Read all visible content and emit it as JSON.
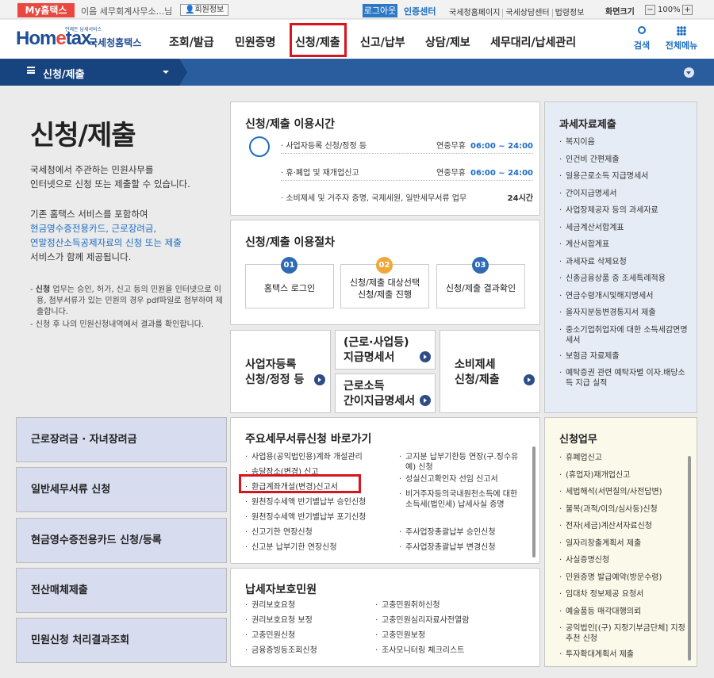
{
  "topbar": {
    "my_home": "My홈택스",
    "user_text": "이음 세무회계사무소...님",
    "member_info": "회원정보",
    "logout": "로그아웃",
    "cert_center": "인증센터",
    "links": [
      "국세청홈페이지",
      "국세상담센터",
      "법령정보"
    ],
    "screen_size_label": "화면크기",
    "zoom_minus": "−",
    "zoom_value": "100%",
    "zoom_plus": "+"
  },
  "header": {
    "logo_small": "언제든 납세서비스",
    "logo_home": "Hom",
    "logo_e": "e",
    "logo_tax": "tax.",
    "logo_kr": "국세청홈택스",
    "menu": [
      "조회/발급",
      "민원증명",
      "신청/제출",
      "신고/납부",
      "상담/제보",
      "세무대리/납세관리"
    ],
    "search": "검색",
    "all_menu": "전체메뉴"
  },
  "subnav": {
    "title": "신청/제출"
  },
  "page": {
    "title": "신청/제출",
    "intro1_line1": "국세청에서 주관하는 민원사무를",
    "intro1_line2": "인터넷으로 신청 또는 제출할 수 있습니다.",
    "intro2_line1": "기존 홈택스 서비스를 포함하여",
    "intro2_blue1": "현금영수증전용카드, 근로장려금,",
    "intro2_blue2": "연말정산소득공제자료의 신청 또는 제출",
    "intro2_line3": "서비스가 함께 제공됩니다.",
    "note1_bold": "신청",
    "note1": " 업무는 승인, 허가, 신고 등의 민원을 인터넷으로 이용, 첨부서류가 있는 민원의 경우 pdf파일로 첨부하여 제출합니다.",
    "note2": "신청 후 나의 민원신청내역에서 결과를 확인합니다."
  },
  "hours": {
    "title": "신청/제출 이용시간",
    "rows": [
      {
        "label": "사업자등록 신청/정정 등",
        "days": "연중무휴",
        "time": "06:00 ~ 24:00"
      },
      {
        "label": "휴·폐업 및 재개업신고",
        "days": "연중무휴",
        "time": "06:00 ~ 24:00"
      },
      {
        "label": "소비제세 및 거주자 증명, 국제세원, 일반세무서류 업무",
        "days": "",
        "time": "24시간"
      }
    ]
  },
  "procedure": {
    "title": "신청/제출 이용절차",
    "steps": [
      {
        "num": "01",
        "line1": "홈택스 로그인",
        "line2": "",
        "color": "#2e6bb4"
      },
      {
        "num": "02",
        "line1": "신청/제출 대상선택",
        "line2": "신청/제출 진행",
        "color": "#f0a63a"
      },
      {
        "num": "03",
        "line1": "신청/제출 결과확인",
        "line2": "",
        "color": "#2e6bb4"
      }
    ]
  },
  "quick": {
    "biz_line1": "사업자등록",
    "biz_line2": "신청/정정 등",
    "pay_line1": "(근로·사업등)",
    "pay_line2": "지급명세서",
    "simple_line1": "근로소득",
    "simple_line2": "간이지급명세서",
    "consume_line1": "소비제세",
    "consume_line2": "신청/제출"
  },
  "tax_data": {
    "title": "과세자료제출",
    "items": [
      "복지이음",
      "인건비 간편제출",
      "일용근로소득 지급명세서",
      "간이지급명세서",
      "사업장제공자 등의 과세자료",
      "세금계산서합계표",
      "계산서합계표",
      "과세자료 삭제요청",
      "신종금융상품 중 조세특례적용",
      "연금수령개시및해지명세서",
      "을자지분등변경통지서 제출",
      "중소기업취업자에 대한 소득세감면명세서",
      "보험금 자료제출",
      "예탁증권 관련 예탁자별 이자.배당소득 지급 실적"
    ]
  },
  "left_menu": [
    "근로장려금 · 자녀장려금",
    "일반세무서류 신청",
    "현금영수증전용카드 신청/등록",
    "전산매체제출",
    "민원신청 처리결과조회"
  ],
  "major_docs": {
    "title": "주요세무서류신청 바로가기",
    "col1": [
      "사업용(공익법인용)계좌 개설관리",
      "송달장소(변경) 신고",
      "환급계좌개설(변경)신고서",
      "원천징수세액 반기별납부 승인신청",
      "원천징수세액 반기별납부 포기신청",
      "신고기한 연장신청",
      "신고분 납부기한 연장신청"
    ],
    "col2": [
      "고지분 납부기한등 연장(구.징수유예) 신청",
      "성실신고확인자 선임 신고서",
      "비거주자등의국내원천소득에 대한 소득세(법인세) 납세사실 증명",
      "주사업장총괄납부 승인신청",
      "주사업장총괄납부 변경신청"
    ]
  },
  "taxpayer": {
    "title": "납세자보호민원",
    "col1": [
      "권리보호요청",
      "권리보호요청 보정",
      "고충민원신청",
      "금융증빙등조회신청"
    ],
    "col2": [
      "고충민원취하신청",
      "고충민원심리자료사전열람",
      "고충민원보정",
      "조사모니터링 체크리스트"
    ]
  },
  "apply_work": {
    "title": "신청업무",
    "items": [
      "휴폐업신고",
      "(휴업자)재개업신고",
      "세법해석(서면질의/사전답변)",
      "불복(과적/이의/심사등)신청",
      "전자(세금)계산서자료신청",
      "일자리창출계획서 제출",
      "사실증명신청",
      "민원증명 발급예약(방문수령)",
      "임대차 정보제공 요청서",
      "예술품등 매각대행의뢰",
      "공익법인[(구) 지정기부금단체] 지정추천 신청",
      "투자확대계획서 제출"
    ]
  }
}
